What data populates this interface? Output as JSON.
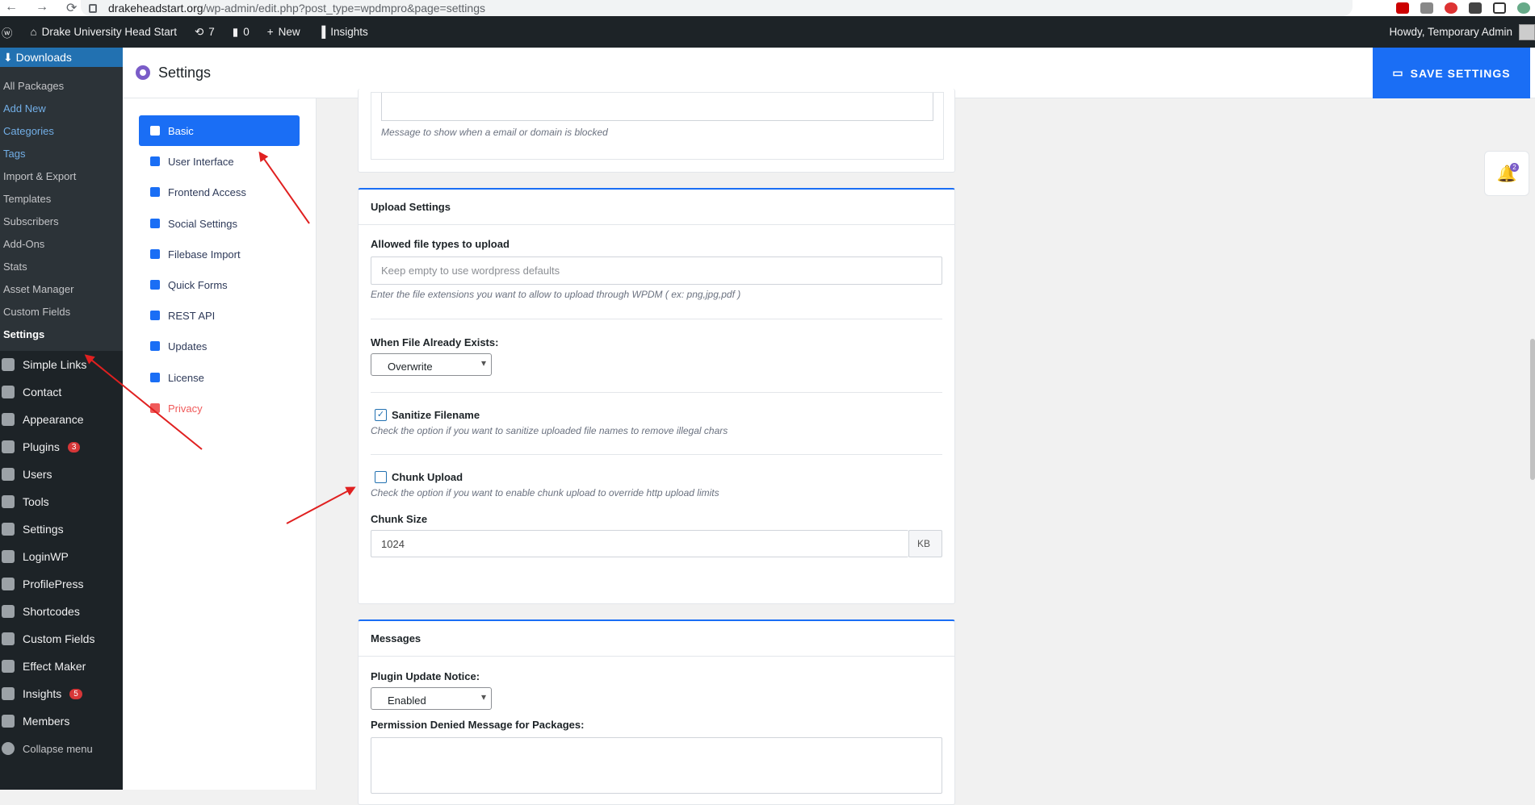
{
  "browser": {
    "url_host": "drakeheadstart.org",
    "url_path": "/wp-admin/edit.php?post_type=wpdmpro&page=settings"
  },
  "adminbar": {
    "site": "Drake University Head Start",
    "updates": "7",
    "comments": "0",
    "new": "New",
    "insights": "Insights",
    "howdy": "Howdy, Temporary Admin"
  },
  "sidebar": {
    "top": "Downloads",
    "submenu": [
      "All Packages",
      "Add New",
      "Categories",
      "Tags",
      "Import & Export",
      "Templates",
      "Subscribers",
      "Add-Ons",
      "Stats",
      "Asset Manager",
      "Custom Fields",
      "Settings"
    ],
    "menu": [
      {
        "label": "Simple Links",
        "icon": "link-icon"
      },
      {
        "label": "Contact",
        "icon": "mail-icon"
      },
      {
        "label": "Appearance",
        "icon": "brush-icon"
      },
      {
        "label": "Plugins",
        "icon": "plug-icon",
        "badge": "3"
      },
      {
        "label": "Users",
        "icon": "user-icon"
      },
      {
        "label": "Tools",
        "icon": "wrench-icon"
      },
      {
        "label": "Settings",
        "icon": "settings-icon"
      },
      {
        "label": "LoginWP",
        "icon": "home-icon"
      },
      {
        "label": "ProfilePress",
        "icon": "profile-icon"
      },
      {
        "label": "Shortcodes",
        "icon": "brackets-icon"
      },
      {
        "label": "Custom Fields",
        "icon": "grid-icon"
      },
      {
        "label": "Effect Maker",
        "icon": "gear-icon"
      },
      {
        "label": "Insights",
        "icon": "chart-icon",
        "badge": "5"
      },
      {
        "label": "Members",
        "icon": "group-icon"
      },
      {
        "label": "Collapse menu",
        "icon": "collapse-icon"
      }
    ]
  },
  "header": {
    "title": "Settings",
    "save": "SAVE SETTINGS"
  },
  "tabs": [
    "Basic",
    "User Interface",
    "Frontend Access",
    "Social Settings",
    "Filebase Import",
    "Quick Forms",
    "REST API",
    "Updates",
    "License",
    "Privacy"
  ],
  "top_card": {
    "help": "Message to show when a email or domain is blocked"
  },
  "upload": {
    "title": "Upload Settings",
    "allowed_label": "Allowed file types to upload",
    "allowed_placeholder": "Keep empty to use wordpress defaults",
    "allowed_help": "Enter the file extensions you want to allow to upload through WPDM ( ex: png,jpg,pdf )",
    "exists_label": "When File Already Exists:",
    "exists_value": "Overwrite",
    "sanitize_label": "Sanitize Filename",
    "sanitize_help": "Check the option if you want to sanitize uploaded file names to remove illegal chars",
    "chunk_label": "Chunk Upload",
    "chunk_help": "Check the option if you want to enable chunk upload to override http upload limits",
    "chunk_size_label": "Chunk Size",
    "chunk_size_value": "1024",
    "chunk_unit": "KB"
  },
  "messages": {
    "title": "Messages",
    "notice_label": "Plugin Update Notice:",
    "notice_value": "Enabled",
    "denied_label": "Permission Denied Message for Packages:"
  },
  "bell_count": "2"
}
